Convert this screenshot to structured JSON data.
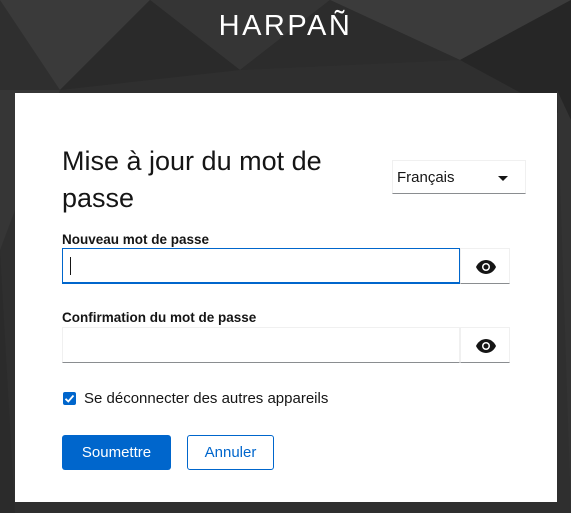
{
  "brand": {
    "name": "HARPAÑ"
  },
  "form": {
    "title": "Mise à jour du mot de passe",
    "language": {
      "selected": "Français"
    },
    "new_password": {
      "label": "Nouveau mot de passe",
      "value": "",
      "show_icon": "eye-icon"
    },
    "confirm_password": {
      "label": "Confirmation du mot de passe",
      "value": "",
      "show_icon": "eye-icon"
    },
    "logout_others": {
      "label": "Se déconnecter des autres appareils",
      "checked": true
    },
    "submit_label": "Soumettre",
    "cancel_label": "Annuler"
  },
  "colors": {
    "primary": "#0066cc",
    "background": "#303030",
    "card": "#ffffff",
    "text": "#151515"
  }
}
